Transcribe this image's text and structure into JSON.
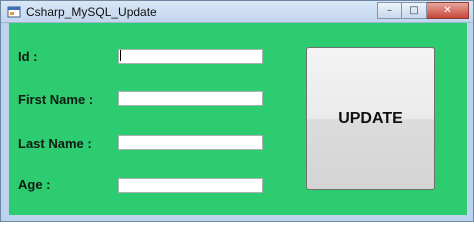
{
  "window": {
    "title": "Csharp_MySQL_Update",
    "minimize_glyph": "–",
    "maximize_glyph": "□",
    "close_glyph": "✕"
  },
  "form": {
    "background_color": "#2ecc71",
    "fields": [
      {
        "label": "Id :",
        "value": ""
      },
      {
        "label": "First Name :",
        "value": ""
      },
      {
        "label": "Last Name :",
        "value": ""
      },
      {
        "label": "Age :",
        "value": ""
      }
    ],
    "update_button_label": "UPDATE"
  },
  "icons": {
    "app": "window-app-icon"
  }
}
